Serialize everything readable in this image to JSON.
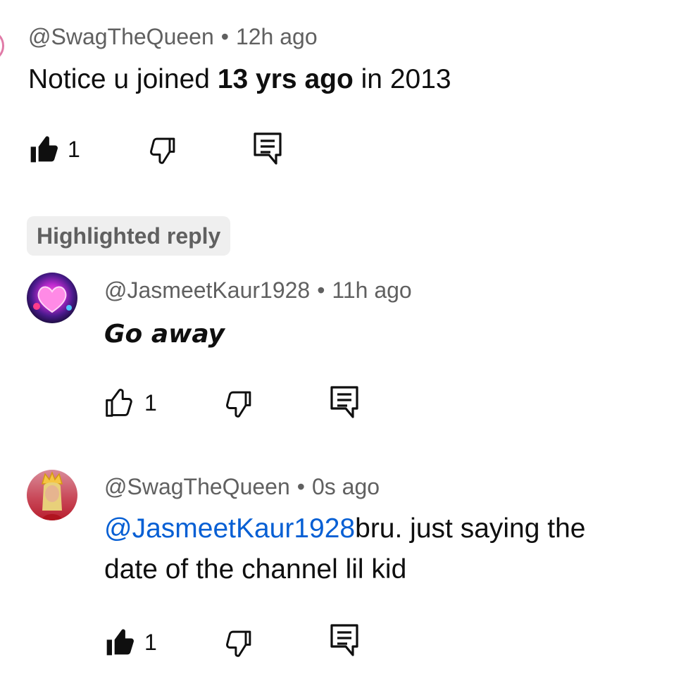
{
  "comment": {
    "author": "@SwagTheQueen",
    "time": "12h ago",
    "text_before": "Notice u joined ",
    "text_bold": "13 yrs ago",
    "text_after": " in 2013",
    "likes": "1"
  },
  "highlight_chip": "Highlighted reply",
  "replies": [
    {
      "author": "@JasmeetKaur1928",
      "time": "11h ago",
      "text": "Go away",
      "likes": "1"
    },
    {
      "author": "@SwagTheQueen",
      "time": "0s ago",
      "mention": "@JasmeetKaur1928",
      "text_line1": "bru. just saying the",
      "text_line2": "date of the channel lil kid",
      "likes": "1"
    }
  ],
  "separator": "•",
  "colors": {
    "text": "#0f0f0f",
    "meta": "#606060",
    "mention": "#065fd4",
    "chip_bg": "#efefef"
  }
}
